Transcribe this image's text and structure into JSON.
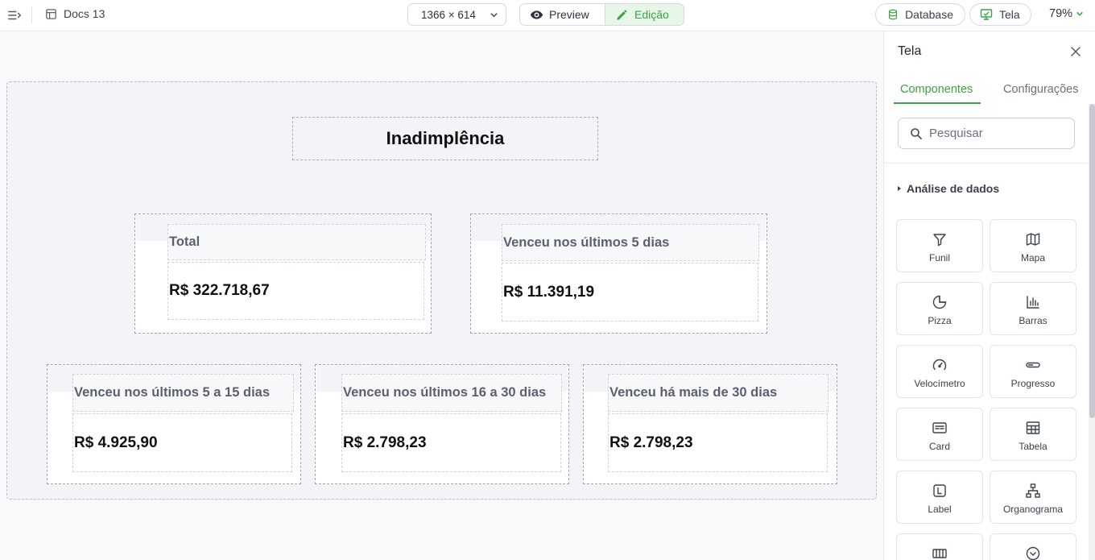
{
  "topbar": {
    "doc_name": "Docs 13",
    "screen_size": "1366 × 614",
    "preview_label": "Preview",
    "edit_label": "Edição",
    "database_label": "Database",
    "tela_label": "Tela",
    "zoom": "79%"
  },
  "canvas": {
    "title": "Inadimplência",
    "kpis": [
      {
        "label": "Total",
        "value": "R$ 322.718,67"
      },
      {
        "label": "Venceu nos últimos 5 dias",
        "value": "R$ 11.391,19"
      },
      {
        "label": "Venceu nos últimos 5 a 15 dias",
        "value": "R$ 4.925,90"
      },
      {
        "label": "Venceu nos últimos 16 a 30 dias",
        "value": "R$ 2.798,23"
      },
      {
        "label": "Venceu há mais de 30 dias",
        "value": "R$ 2.798,23"
      }
    ]
  },
  "panel": {
    "title": "Tela",
    "tabs": [
      {
        "label": "Componentes"
      },
      {
        "label": "Configurações"
      }
    ],
    "search_placeholder": "Pesquisar",
    "section": "Análise de dados",
    "components": [
      {
        "label": "Funil",
        "icon": "funnel-icon"
      },
      {
        "label": "Mapa",
        "icon": "map-icon"
      },
      {
        "label": "Pizza",
        "icon": "pie-chart-icon"
      },
      {
        "label": "Barras",
        "icon": "bar-chart-icon"
      },
      {
        "label": "Velocímetro",
        "icon": "gauge-icon"
      },
      {
        "label": "Progresso",
        "icon": "progress-icon"
      },
      {
        "label": "Card",
        "icon": "card-icon"
      },
      {
        "label": "Tabela",
        "icon": "table-icon"
      },
      {
        "label": "Label",
        "icon": "label-icon"
      },
      {
        "label": "Organograma",
        "icon": "org-chart-icon"
      }
    ]
  },
  "colors": {
    "accent": "#3aa344",
    "accent_bg": "#e7f6e8",
    "canvas_bg": "#f3f4f7"
  }
}
